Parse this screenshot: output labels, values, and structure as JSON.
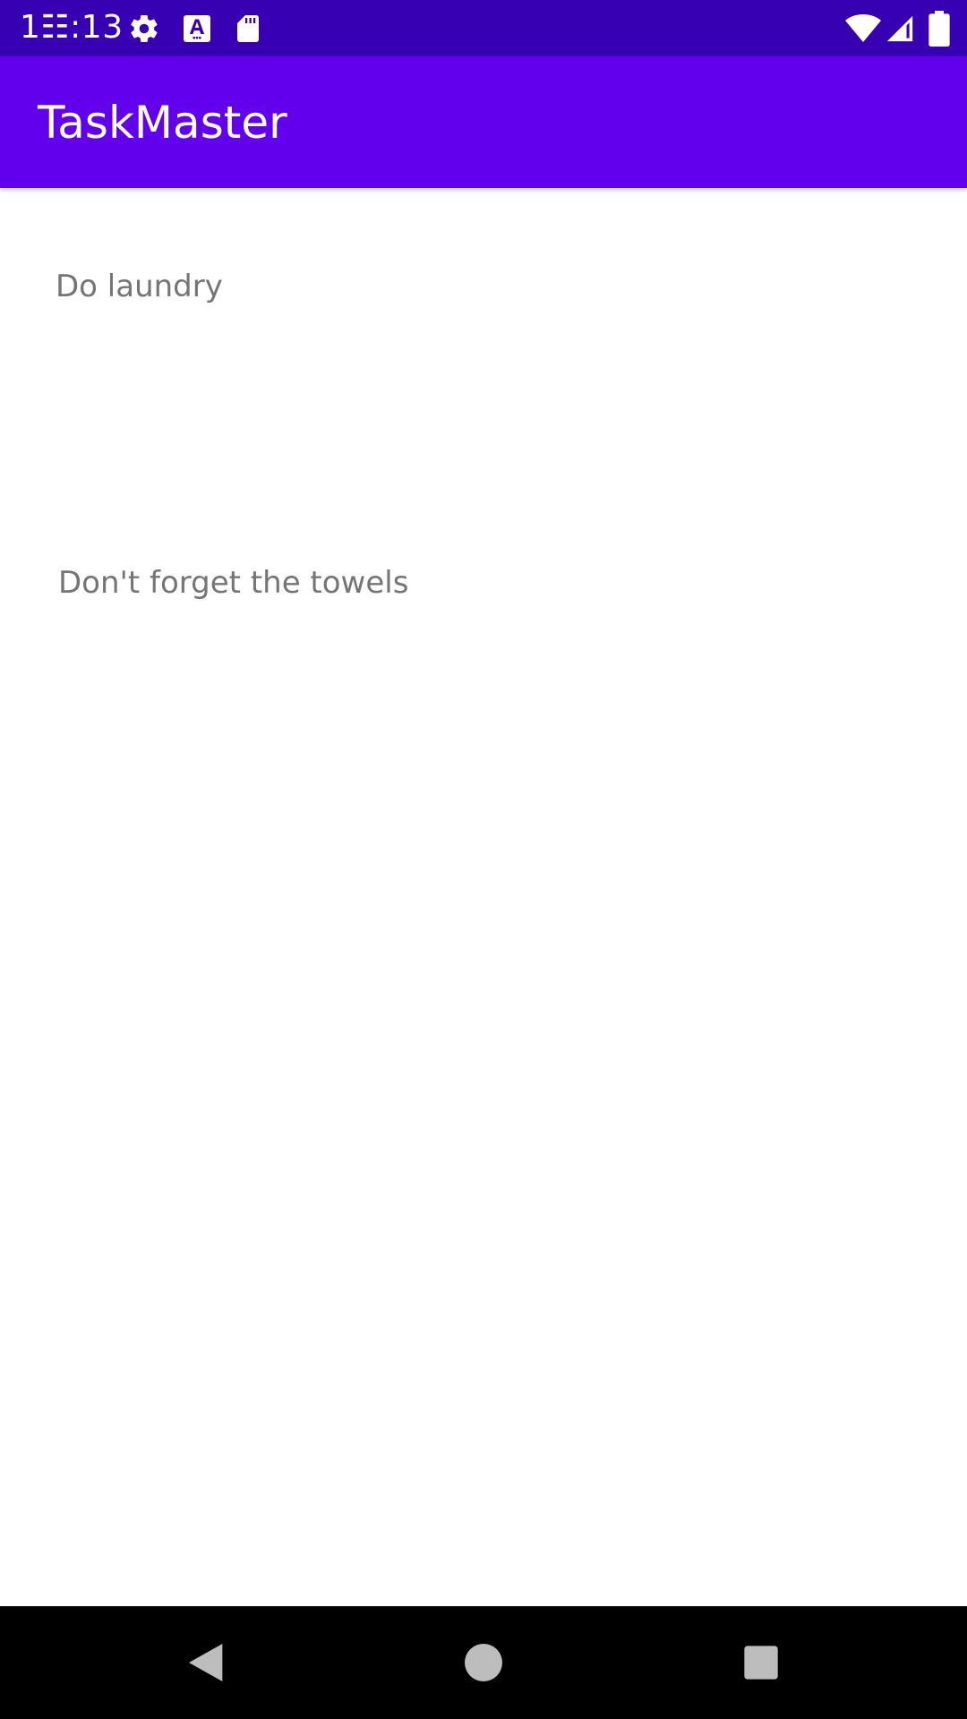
{
  "status_bar": {
    "time": "1☷:13",
    "left_icons": [
      "gear-icon",
      "text-a-icon",
      "sd-card-icon"
    ],
    "right_icons": [
      "wifi-icon",
      "cell-signal-icon",
      "battery-icon"
    ]
  },
  "app_bar": {
    "title": "TaskMaster"
  },
  "task": {
    "title": "Do laundry",
    "body": "Don't forget the towels"
  },
  "nav_bar": {
    "buttons": [
      "back-icon",
      "home-icon",
      "recents-icon"
    ]
  },
  "colors": {
    "status_bar": "#3700b3",
    "app_bar": "#6200ee",
    "text_secondary": "#757575",
    "nav_bar": "#000000"
  }
}
